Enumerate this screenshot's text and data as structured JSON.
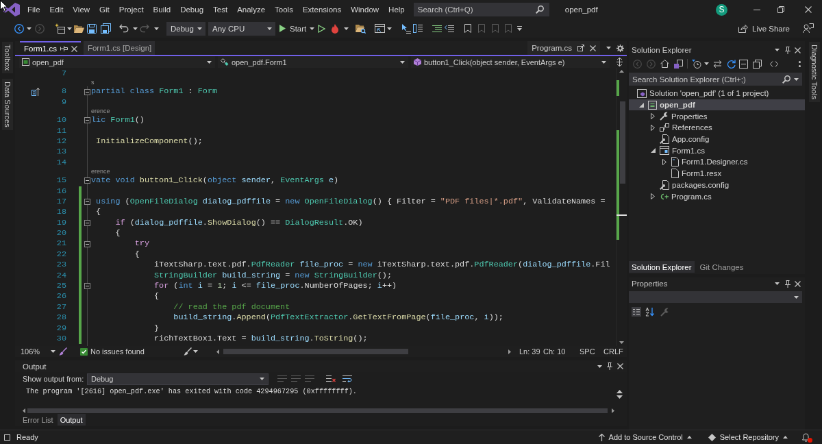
{
  "title_bar": {
    "menu": [
      "File",
      "Edit",
      "View",
      "Git",
      "Project",
      "Build",
      "Debug",
      "Test",
      "Analyze",
      "Tools",
      "Extensions",
      "Window",
      "Help"
    ],
    "search": {
      "placeholder": "Search (Ctrl+Q)"
    },
    "title": "open_pdf",
    "account_initial": "S"
  },
  "toolbar": {
    "configuration": "Debug",
    "platform": "Any CPU",
    "start": "Start",
    "live_share": "Live Share"
  },
  "left_strip": [
    "Toolbox",
    "Data Sources"
  ],
  "right_strip": [
    "Diagnostic Tools"
  ],
  "editor": {
    "tabs": [
      {
        "label": "Form1.cs",
        "selected": true
      },
      {
        "label": "Form1.cs [Design]",
        "selected": false
      }
    ],
    "preview_tab": "Program.cs",
    "navigation": [
      "open_pdf",
      "open_pdf.Form1",
      "button1_Click(object sender, EventArgs e)"
    ],
    "lines": [
      {
        "kind": "code",
        "number": "7",
        "fold": false,
        "changed": false,
        "margin_icon": false
      },
      {
        "kind": "codelens",
        "text": "s"
      },
      {
        "kind": "code",
        "number": "8",
        "tokens": [
          {
            "text": "partial class ",
            "kind": "keyword"
          },
          {
            "text": "Form1",
            "kind": "type"
          },
          {
            "text": " : ",
            "kind": "plain"
          },
          {
            "text": "Form",
            "kind": "type"
          }
        ],
        "fold": true,
        "changed": false,
        "margin_icon": true
      },
      {
        "kind": "code",
        "number": "9",
        "fold": false,
        "changed": false,
        "margin_icon": false
      },
      {
        "kind": "codelens",
        "text": "erence"
      },
      {
        "kind": "code",
        "number": "10",
        "tokens": [
          {
            "text": "lic ",
            "kind": "keyword"
          },
          {
            "text": "Form1",
            "kind": "type"
          },
          {
            "text": "()",
            "kind": "plain"
          }
        ],
        "fold": true,
        "changed": false,
        "margin_icon": false
      },
      {
        "kind": "code",
        "number": "11",
        "fold": false,
        "changed": false,
        "margin_icon": false
      },
      {
        "kind": "code",
        "number": "12",
        "tokens": [
          {
            "text": " InitializeComponent",
            "kind": "method"
          },
          {
            "text": "();",
            "kind": "plain"
          }
        ],
        "fold": false,
        "changed": false,
        "margin_icon": false
      },
      {
        "kind": "code",
        "number": "13",
        "fold": false,
        "changed": false,
        "margin_icon": false
      },
      {
        "kind": "code",
        "number": "14",
        "fold": false,
        "changed": false,
        "margin_icon": false
      },
      {
        "kind": "codelens",
        "text": "erence"
      },
      {
        "kind": "code",
        "number": "15",
        "tokens": [
          {
            "text": "vate void ",
            "kind": "keyword"
          },
          {
            "text": "button1_Click",
            "kind": "method"
          },
          {
            "text": "(",
            "kind": "plain"
          },
          {
            "text": "object ",
            "kind": "keyword"
          },
          {
            "text": "sender",
            "kind": "variable"
          },
          {
            "text": ", ",
            "kind": "plain"
          },
          {
            "text": "EventArgs ",
            "kind": "type"
          },
          {
            "text": "e",
            "kind": "variable"
          },
          {
            "text": ")",
            "kind": "plain"
          }
        ],
        "fold": true,
        "changed": false,
        "margin_icon": false
      },
      {
        "kind": "code",
        "number": "16",
        "fold": false,
        "changed": true,
        "margin_icon": false
      },
      {
        "kind": "code",
        "number": "17",
        "tokens": [
          {
            "text": " using ",
            "kind": "keyword"
          },
          {
            "text": "(",
            "kind": "plain"
          },
          {
            "text": "OpenFileDialog ",
            "kind": "type"
          },
          {
            "text": "dialog_pdffile",
            "kind": "variable"
          },
          {
            "text": " = ",
            "kind": "plain"
          },
          {
            "text": "new ",
            "kind": "keyword"
          },
          {
            "text": "OpenFileDialog",
            "kind": "type"
          },
          {
            "text": "() { Filter = ",
            "kind": "plain"
          },
          {
            "text": "\"PDF files|*.pdf\"",
            "kind": "string"
          },
          {
            "text": ", ValidateNames =",
            "kind": "plain"
          }
        ],
        "fold": true,
        "changed": true,
        "margin_icon": false
      },
      {
        "kind": "code",
        "number": "18",
        "tokens": [
          {
            "text": " {",
            "kind": "plain"
          }
        ],
        "fold": false,
        "changed": true,
        "margin_icon": false
      },
      {
        "kind": "code",
        "number": "19",
        "tokens": [
          {
            "text": "     if ",
            "kind": "control"
          },
          {
            "text": "(",
            "kind": "plain"
          },
          {
            "text": "dialog_pdffile",
            "kind": "variable"
          },
          {
            "text": ".",
            "kind": "plain"
          },
          {
            "text": "ShowDialog",
            "kind": "method"
          },
          {
            "text": "() == ",
            "kind": "plain"
          },
          {
            "text": "DialogResult",
            "kind": "type"
          },
          {
            "text": ".OK)",
            "kind": "plain"
          }
        ],
        "fold": true,
        "changed": true,
        "margin_icon": false
      },
      {
        "kind": "code",
        "number": "20",
        "tokens": [
          {
            "text": "     {",
            "kind": "plain"
          }
        ],
        "fold": false,
        "changed": true,
        "margin_icon": false
      },
      {
        "kind": "code",
        "number": "21",
        "tokens": [
          {
            "text": "         try",
            "kind": "control"
          }
        ],
        "fold": true,
        "changed": true,
        "margin_icon": false
      },
      {
        "kind": "code",
        "number": "22",
        "tokens": [
          {
            "text": "         {",
            "kind": "plain"
          }
        ],
        "fold": false,
        "changed": true,
        "margin_icon": false
      },
      {
        "kind": "code",
        "number": "23",
        "tokens": [
          {
            "text": "             iTextSharp.text.pdf.",
            "kind": "plain"
          },
          {
            "text": "PdfReader ",
            "kind": "type"
          },
          {
            "text": "file_proc",
            "kind": "variable"
          },
          {
            "text": " = ",
            "kind": "plain"
          },
          {
            "text": "new ",
            "kind": "keyword"
          },
          {
            "text": "iTextSharp.text.pdf.",
            "kind": "plain"
          },
          {
            "text": "PdfReader",
            "kind": "type"
          },
          {
            "text": "(",
            "kind": "plain"
          },
          {
            "text": "dialog_pdffile",
            "kind": "variable"
          },
          {
            "text": ".Fil",
            "kind": "plain"
          }
        ],
        "fold": false,
        "changed": true,
        "margin_icon": false
      },
      {
        "kind": "code",
        "number": "24",
        "tokens": [
          {
            "text": "             StringBuilder ",
            "kind": "type"
          },
          {
            "text": "build_string",
            "kind": "variable"
          },
          {
            "text": " = ",
            "kind": "plain"
          },
          {
            "text": "new ",
            "kind": "keyword"
          },
          {
            "text": "StringBuilder",
            "kind": "type"
          },
          {
            "text": "();",
            "kind": "plain"
          }
        ],
        "fold": false,
        "changed": true,
        "margin_icon": false
      },
      {
        "kind": "code",
        "number": "25",
        "tokens": [
          {
            "text": "             for ",
            "kind": "control"
          },
          {
            "text": "(",
            "kind": "plain"
          },
          {
            "text": "int ",
            "kind": "keyword"
          },
          {
            "text": "i",
            "kind": "variable"
          },
          {
            "text": " = ",
            "kind": "plain"
          },
          {
            "text": "1",
            "kind": "number"
          },
          {
            "text": "; ",
            "kind": "plain"
          },
          {
            "text": "i",
            "kind": "variable"
          },
          {
            "text": " <= ",
            "kind": "plain"
          },
          {
            "text": "file_proc",
            "kind": "variable"
          },
          {
            "text": ".NumberOfPages; ",
            "kind": "plain"
          },
          {
            "text": "i",
            "kind": "variable"
          },
          {
            "text": "++)",
            "kind": "plain"
          }
        ],
        "fold": true,
        "changed": true,
        "margin_icon": false
      },
      {
        "kind": "code",
        "number": "26",
        "tokens": [
          {
            "text": "             {",
            "kind": "plain"
          }
        ],
        "fold": false,
        "changed": true,
        "margin_icon": false
      },
      {
        "kind": "code",
        "number": "27",
        "tokens": [
          {
            "text": "                 // read the pdf document",
            "kind": "comment"
          }
        ],
        "fold": false,
        "changed": true,
        "margin_icon": false
      },
      {
        "kind": "code",
        "number": "28",
        "tokens": [
          {
            "text": "                 build_string",
            "kind": "variable"
          },
          {
            "text": ".",
            "kind": "plain"
          },
          {
            "text": "Append",
            "kind": "method"
          },
          {
            "text": "(",
            "kind": "plain"
          },
          {
            "text": "PdfTextExtractor",
            "kind": "type"
          },
          {
            "text": ".",
            "kind": "plain"
          },
          {
            "text": "GetTextFromPage",
            "kind": "method"
          },
          {
            "text": "(",
            "kind": "plain"
          },
          {
            "text": "file_proc",
            "kind": "variable"
          },
          {
            "text": ", ",
            "kind": "plain"
          },
          {
            "text": "i",
            "kind": "variable"
          },
          {
            "text": "));",
            "kind": "plain"
          }
        ],
        "fold": false,
        "changed": true,
        "margin_icon": false
      },
      {
        "kind": "code",
        "number": "29",
        "tokens": [
          {
            "text": "             }",
            "kind": "plain"
          }
        ],
        "fold": false,
        "changed": true,
        "margin_icon": false
      },
      {
        "kind": "code",
        "number": "30",
        "tokens": [
          {
            "text": "             richTextBox1.Text = ",
            "kind": "plain"
          },
          {
            "text": "build_string",
            "kind": "variable"
          },
          {
            "text": ".",
            "kind": "plain"
          },
          {
            "text": "ToString",
            "kind": "method"
          },
          {
            "text": "();",
            "kind": "plain"
          }
        ],
        "fold": false,
        "changed": true,
        "margin_icon": false
      }
    ],
    "zoom": "106%",
    "issues": "No issues found",
    "position": [
      "Ln: 39",
      "Ch: 10",
      "SPC",
      "CRLF"
    ]
  },
  "output": {
    "title": "Output",
    "source_label": "Show output from:",
    "source": "Debug",
    "lines": [
      "The program '[2616] open_pdf.exe' has exited with code 4294967295 (0xffffffff)."
    ],
    "tabs": [
      {
        "label": "Error List",
        "selected": false
      },
      {
        "label": "Output",
        "selected": true
      }
    ]
  },
  "solution_explorer": {
    "title": "Solution Explorer",
    "search": {
      "placeholder": "Search Solution Explorer (Ctrl+;)"
    },
    "tree": [
      {
        "label": "Solution 'open_pdf' (1 of 1 project)",
        "kind": "solution",
        "selected": false,
        "emphasized": false,
        "children": [
          {
            "label": "open_pdf",
            "kind": "project",
            "expanded": true,
            "selected": true,
            "emphasized": true,
            "children": [
              {
                "label": "Properties",
                "kind": "properties",
                "expanded": false,
                "selected": false,
                "emphasized": false
              },
              {
                "label": "References",
                "kind": "references",
                "expanded": false,
                "selected": false,
                "emphasized": false
              },
              {
                "label": "App.config",
                "kind": "config",
                "selected": false,
                "emphasized": false
              },
              {
                "label": "Form1.cs",
                "kind": "form",
                "expanded": true,
                "selected": false,
                "emphasized": false,
                "children": [
                  {
                    "label": "Form1.Designer.cs",
                    "kind": "code-file",
                    "expanded": false,
                    "selected": false,
                    "emphasized": false
                  },
                  {
                    "label": "Form1.resx",
                    "kind": "resource-file",
                    "selected": false,
                    "emphasized": false
                  }
                ]
              },
              {
                "label": "packages.config",
                "kind": "config",
                "selected": false,
                "emphasized": false
              },
              {
                "label": "Program.cs",
                "kind": "csharp-file",
                "expanded": false,
                "selected": false,
                "emphasized": false
              }
            ]
          }
        ]
      }
    ],
    "tabs": [
      {
        "label": "Solution Explorer",
        "selected": true
      },
      {
        "label": "Git Changes",
        "selected": false
      }
    ]
  },
  "properties": {
    "title": "Properties"
  },
  "status_bar": {
    "text": "Ready",
    "source_control": "Add to Source Control",
    "repository": "Select Repository"
  }
}
